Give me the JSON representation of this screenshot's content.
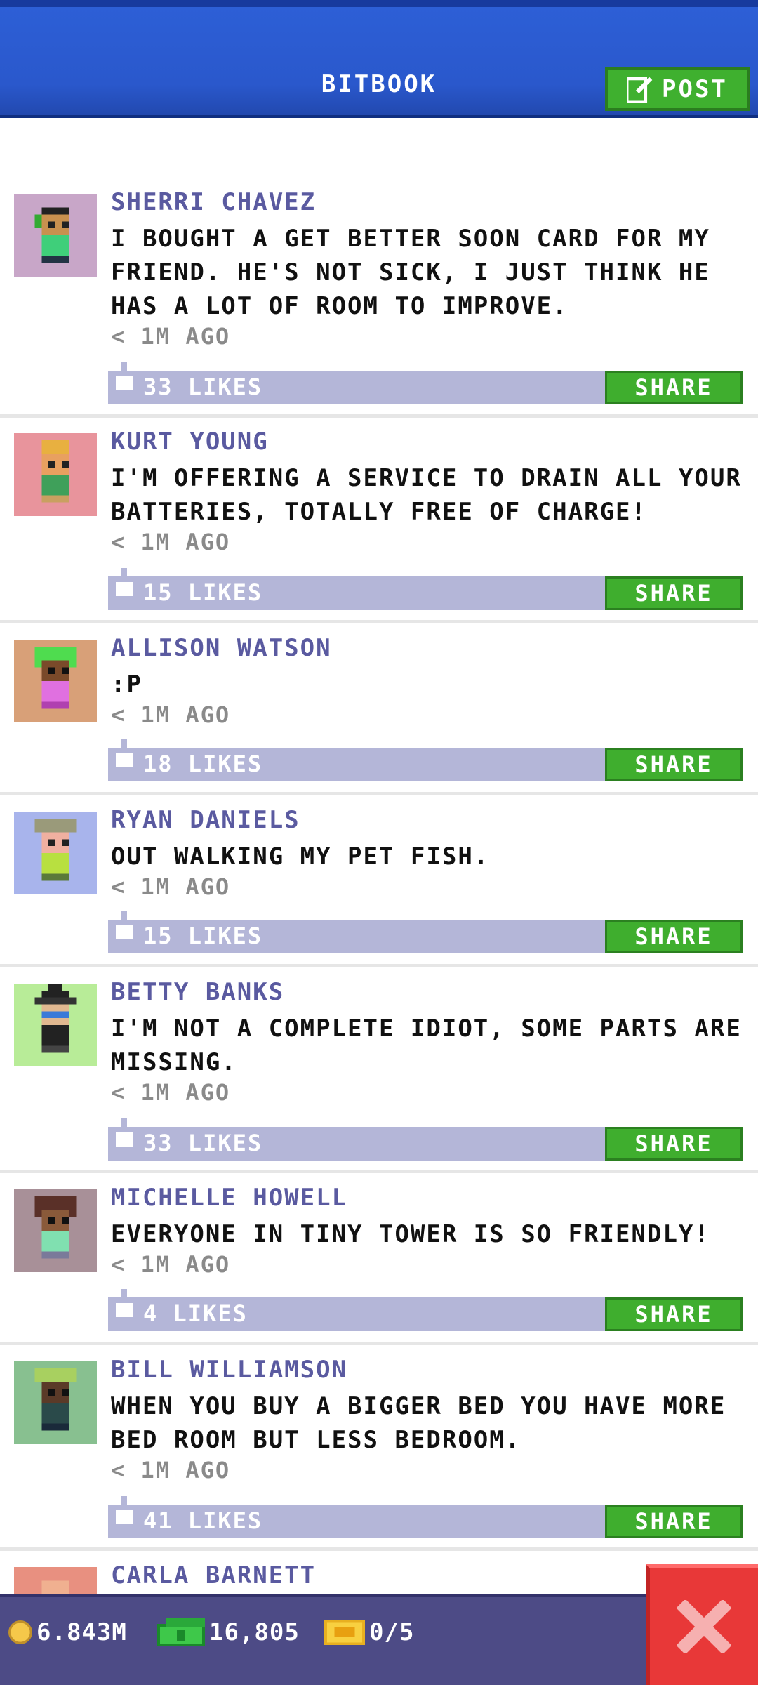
{
  "header": {
    "title": "BITBOOK",
    "post_label": "POST"
  },
  "posts": [
    {
      "name": "SHERRI CHAVEZ",
      "text": "I BOUGHT A GET BETTER SOON CARD FOR MY FRIEND. HE'S NOT SICK, I JUST THINK HE HAS A LOT OF ROOM TO IMPROVE.",
      "time": "< 1M AGO",
      "likes": "33 LIKES",
      "share": "SHARE"
    },
    {
      "name": "KURT YOUNG",
      "text": "I'M OFFERING A SERVICE TO DRAIN ALL YOUR BATTERIES, TOTALLY FREE OF CHARGE!",
      "time": "< 1M AGO",
      "likes": "15 LIKES",
      "share": "SHARE"
    },
    {
      "name": "ALLISON WATSON",
      "text": ":P",
      "time": "< 1M AGO",
      "likes": "18 LIKES",
      "share": "SHARE"
    },
    {
      "name": "RYAN DANIELS",
      "text": "OUT WALKING MY PET FISH.",
      "time": "< 1M AGO",
      "likes": "15 LIKES",
      "share": "SHARE"
    },
    {
      "name": "BETTY BANKS",
      "text": "I'M NOT A COMPLETE IDIOT, SOME PARTS ARE MISSING.",
      "time": "< 1M AGO",
      "likes": "33 LIKES",
      "share": "SHARE"
    },
    {
      "name": "MICHELLE HOWELL",
      "text": "EVERYONE IN TINY TOWER IS SO FRIENDLY!",
      "time": "< 1M AGO",
      "likes": "4 LIKES",
      "share": "SHARE"
    },
    {
      "name": "BILL WILLIAMSON",
      "text": "WHEN YOU BUY A BIGGER BED YOU HAVE MORE BED ROOM BUT LESS BEDROOM.",
      "time": "< 1M AGO",
      "likes": "41 LIKES",
      "share": "SHARE"
    },
    {
      "name": "CARLA BARNETT"
    }
  ],
  "status": {
    "coins": "6.843M",
    "bux": "16,805",
    "tickets": "0/5"
  },
  "colors": {
    "header": "#2a58cc",
    "share_green": "#3fae2e",
    "likes_bar": "#b4b6d8",
    "name": "#5a5aa0",
    "close_red": "#e83838",
    "bottom_bar": "#4d4b86"
  }
}
